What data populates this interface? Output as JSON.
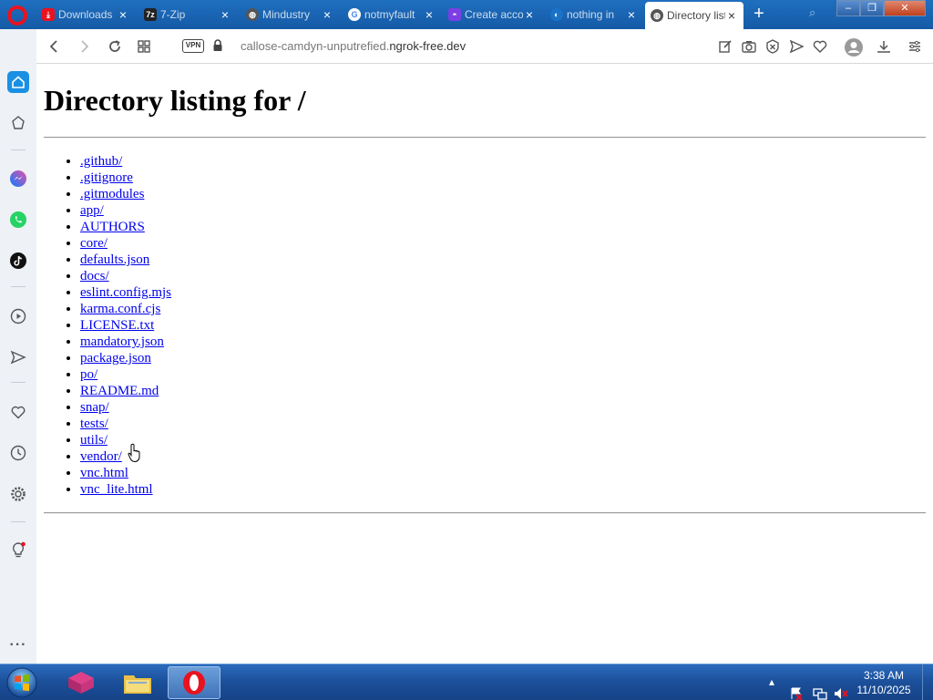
{
  "browser": {
    "tabs": [
      {
        "title": "Downloads",
        "icon": "downloads-icon",
        "color": "#e8131f",
        "glyph": "⤓"
      },
      {
        "title": "7-Zip",
        "icon": "7zip-icon",
        "color": "#222222",
        "glyph": "7z"
      },
      {
        "title": "Mindustry",
        "icon": "globe-icon",
        "color": "#555555",
        "glyph": "◍"
      },
      {
        "title": "notmyfault",
        "icon": "google-icon",
        "color": "#4285f4",
        "glyph": "G"
      },
      {
        "title": "Create account",
        "icon": "app-icon",
        "color": "#7b3fe4",
        "glyph": "◓"
      },
      {
        "title": "nothing in",
        "icon": "edge-icon",
        "color": "#1a73c8",
        "glyph": "◐"
      },
      {
        "title": "Directory listing",
        "icon": "globe-icon",
        "color": "#555555",
        "glyph": "◍",
        "active": true
      }
    ],
    "address": {
      "prefix": "callose-camdyn-unputrefied.",
      "host": "ngrok-free.dev",
      "vpn_label": "VPN"
    }
  },
  "page": {
    "heading": "Directory listing for /",
    "entries": [
      ".github/",
      ".gitignore",
      ".gitmodules",
      "app/",
      "AUTHORS",
      "core/",
      "defaults.json",
      "docs/",
      "eslint.config.mjs",
      "karma.conf.cjs",
      "LICENSE.txt",
      "mandatory.json",
      "package.json",
      "po/",
      "README.md",
      "snap/",
      "tests/",
      "utils/",
      "vendor/",
      "vnc.html",
      "vnc_lite.html"
    ]
  },
  "taskbar": {
    "time": "3:38 AM",
    "date": "11/10/2025"
  },
  "colors": {
    "link": "#0000ee",
    "sidebar_active": "#1a8fe3",
    "opera_red": "#e8131f"
  }
}
